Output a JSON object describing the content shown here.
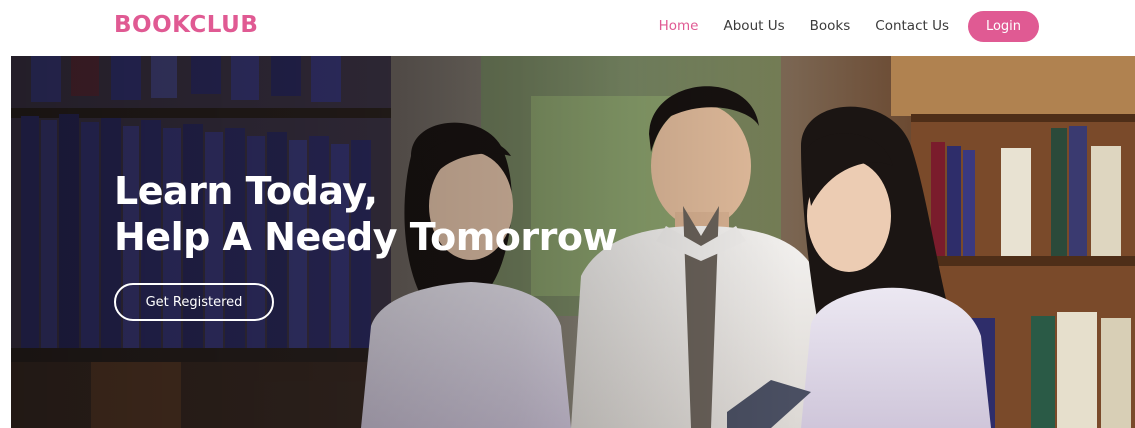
{
  "brand": {
    "name": "BOOKCLUB"
  },
  "nav": {
    "links": [
      {
        "label": "Home",
        "active": true
      },
      {
        "label": "About Us",
        "active": false
      },
      {
        "label": "Books",
        "active": false
      },
      {
        "label": "Contact Us",
        "active": false
      }
    ],
    "login_label": "Login"
  },
  "hero": {
    "title_line1": "Learn Today,",
    "title_line2": "Help A Needy Tomorrow",
    "cta_label": "Get Registered"
  },
  "colors": {
    "accent": "#e05a93",
    "nav_text": "#3b3b3b",
    "hero_text": "#ffffff"
  }
}
